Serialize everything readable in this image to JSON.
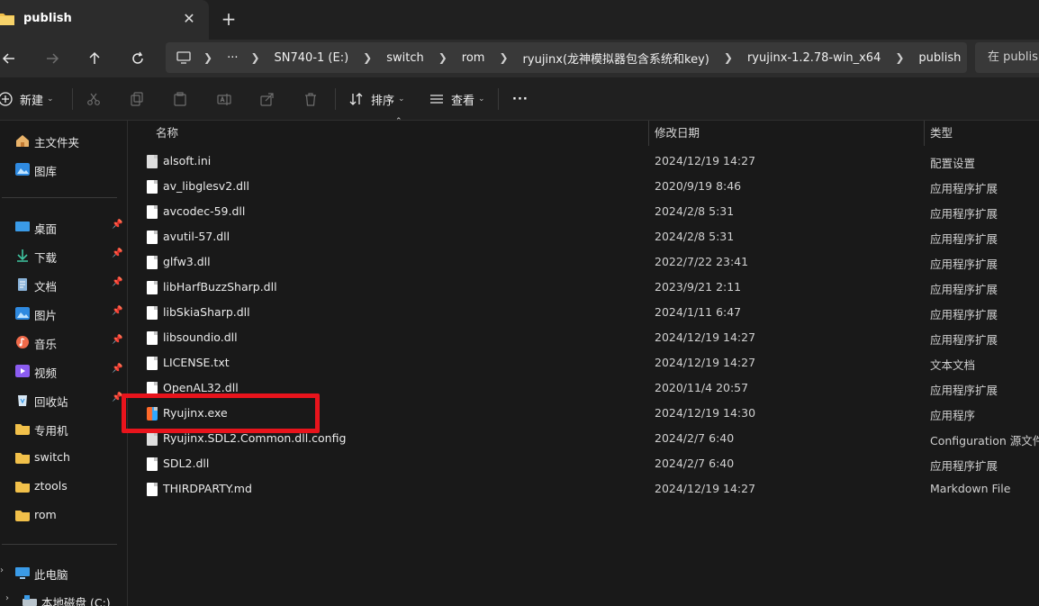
{
  "tab": {
    "title": "publish",
    "close": "✕",
    "new": "+"
  },
  "address": {
    "crumbs": [
      "SN740-1 (E:)",
      "switch",
      "rom",
      "ryujinx(龙神模拟器包含系统和key)",
      "ryujinx-1.2.78-win_x64",
      "publish"
    ],
    "more": "···",
    "search_placeholder": "在 publish 中搜索"
  },
  "toolbar": {
    "new_label": "新建",
    "sort_label": "排序",
    "view_label": "查看",
    "more": "···"
  },
  "sidebar": {
    "top": [
      {
        "label": "主文件夹",
        "icon": "home-icon"
      },
      {
        "label": "图库",
        "icon": "gallery-icon"
      }
    ],
    "quick": [
      {
        "label": "桌面",
        "icon": "desktop-icon"
      },
      {
        "label": "下载",
        "icon": "download-icon"
      },
      {
        "label": "文档",
        "icon": "document-icon"
      },
      {
        "label": "图片",
        "icon": "picture-icon"
      },
      {
        "label": "音乐",
        "icon": "music-icon"
      },
      {
        "label": "视频",
        "icon": "video-icon"
      },
      {
        "label": "回收站",
        "icon": "recycle-icon"
      },
      {
        "label": "专用机",
        "icon": "folder-icon"
      },
      {
        "label": "switch",
        "icon": "folder-icon"
      },
      {
        "label": "ztools",
        "icon": "folder-icon"
      },
      {
        "label": "rom",
        "icon": "folder-icon"
      }
    ],
    "pc": {
      "label": "此电脑",
      "icon": "pc-icon"
    },
    "drive": {
      "label": "本地磁盘 (C:)",
      "icon": "drive-icon"
    }
  },
  "columns": {
    "name": "名称",
    "date": "修改日期",
    "type": "类型"
  },
  "files": [
    {
      "name": "alsoft.ini",
      "date": "2024/12/19 14:27",
      "type": "配置设置",
      "icon": "cfg"
    },
    {
      "name": "av_libglesv2.dll",
      "date": "2020/9/19 8:46",
      "type": "应用程序扩展",
      "icon": "dll"
    },
    {
      "name": "avcodec-59.dll",
      "date": "2024/2/8 5:31",
      "type": "应用程序扩展",
      "icon": "dll"
    },
    {
      "name": "avutil-57.dll",
      "date": "2024/2/8 5:31",
      "type": "应用程序扩展",
      "icon": "dll"
    },
    {
      "name": "glfw3.dll",
      "date": "2022/7/22 23:41",
      "type": "应用程序扩展",
      "icon": "dll"
    },
    {
      "name": "libHarfBuzzSharp.dll",
      "date": "2023/9/21 2:11",
      "type": "应用程序扩展",
      "icon": "dll"
    },
    {
      "name": "libSkiaSharp.dll",
      "date": "2024/1/11 6:47",
      "type": "应用程序扩展",
      "icon": "dll"
    },
    {
      "name": "libsoundio.dll",
      "date": "2024/12/19 14:27",
      "type": "应用程序扩展",
      "icon": "dll"
    },
    {
      "name": "LICENSE.txt",
      "date": "2024/12/19 14:27",
      "type": "文本文档",
      "icon": "txt"
    },
    {
      "name": "OpenAL32.dll",
      "date": "2020/11/4 20:57",
      "type": "应用程序扩展",
      "icon": "dll"
    },
    {
      "name": "Ryujinx.exe",
      "date": "2024/12/19 14:30",
      "type": "应用程序",
      "icon": "exe"
    },
    {
      "name": "Ryujinx.SDL2.Common.dll.config",
      "date": "2024/2/7 6:40",
      "type": "Configuration 源文件",
      "icon": "cfg"
    },
    {
      "name": "SDL2.dll",
      "date": "2024/2/7 6:40",
      "type": "应用程序扩展",
      "icon": "dll"
    },
    {
      "name": "THIRDPARTY.md",
      "date": "2024/12/19 14:27",
      "type": "Markdown File",
      "icon": "txt"
    }
  ],
  "colors": {
    "highlight": "#e8141c",
    "folder": "#f1c04a",
    "accent": "#4aa3f0"
  }
}
